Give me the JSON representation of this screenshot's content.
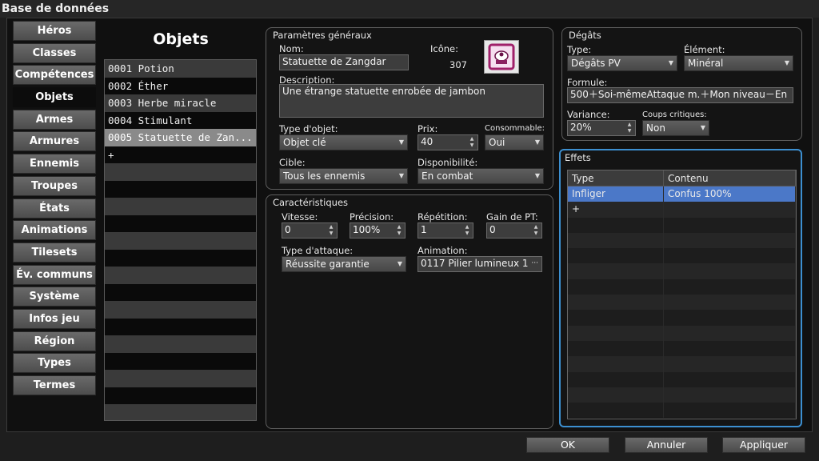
{
  "window": {
    "title": "Base de données"
  },
  "nav": {
    "items": [
      {
        "label": "Héros"
      },
      {
        "label": "Classes"
      },
      {
        "label": "Compétences"
      },
      {
        "label": "Objets"
      },
      {
        "label": "Armes"
      },
      {
        "label": "Armures"
      },
      {
        "label": "Ennemis"
      },
      {
        "label": "Troupes"
      },
      {
        "label": "États"
      },
      {
        "label": "Animations"
      },
      {
        "label": "Tilesets"
      },
      {
        "label": "Év. communs"
      },
      {
        "label": "Système"
      },
      {
        "label": "Infos jeu"
      },
      {
        "label": "Région"
      },
      {
        "label": "Types"
      },
      {
        "label": "Termes"
      }
    ],
    "active_index": 3
  },
  "list": {
    "title": "Objets",
    "items": [
      {
        "label": "0001 Potion"
      },
      {
        "label": "0002 Éther"
      },
      {
        "label": "0003 Herbe miracle"
      },
      {
        "label": "0004 Stimulant"
      },
      {
        "label": "0005 Statuette de Zan..."
      },
      {
        "label": "+"
      }
    ],
    "selected_index": 4
  },
  "general": {
    "title": "Paramètres généraux",
    "name_label": "Nom:",
    "name_value": "Statuette de Zangdar",
    "icon_label": "Icône:",
    "icon_index": "307",
    "desc_label": "Description:",
    "desc_value": "Une étrange statuette enrobée de jambon",
    "type_label": "Type d'objet:",
    "type_value": "Objet clé",
    "price_label": "Prix:",
    "price_value": "40",
    "consumable_label": "Consommable:",
    "consumable_value": "Oui",
    "target_label": "Cible:",
    "target_value": "Tous les ennemis",
    "availability_label": "Disponibilité:",
    "availability_value": "En combat"
  },
  "characteristics": {
    "title": "Caractéristiques",
    "speed_label": "Vitesse:",
    "speed_value": "0",
    "precision_label": "Précision:",
    "precision_value": "100%",
    "repeat_label": "Répétition:",
    "repeat_value": "1",
    "tp_label": "Gain de PT:",
    "tp_value": "0",
    "attack_type_label": "Type d'attaque:",
    "attack_type_value": "Réussite garantie",
    "animation_label": "Animation:",
    "animation_value": "0117 Pilier lumineux 1",
    "animation_more": "···"
  },
  "damage": {
    "title": "Dégâts",
    "type_label": "Type:",
    "type_value": "Dégâts PV",
    "element_label": "Élément:",
    "element_value": "Minéral",
    "formula_label": "Formule:",
    "formula_value": "500＋Soi-mêmeAttaque m.＋Mon niveau－En",
    "variance_label": "Variance:",
    "variance_value": "20%",
    "critical_label": "Coups critiques:",
    "critical_value": "Non"
  },
  "effects": {
    "title": "Effets",
    "columns": [
      "Type",
      "Contenu"
    ],
    "rows": [
      {
        "type": "Infliger",
        "content": "Confus 100%"
      },
      {
        "type": "+",
        "content": ""
      }
    ]
  },
  "buttons": {
    "ok": "OK",
    "cancel": "Annuler",
    "apply": "Appliquer"
  },
  "colors": {
    "accent": "#3c8fd0",
    "selection": "#4b78c8",
    "icon_frame": "#a0206a"
  }
}
